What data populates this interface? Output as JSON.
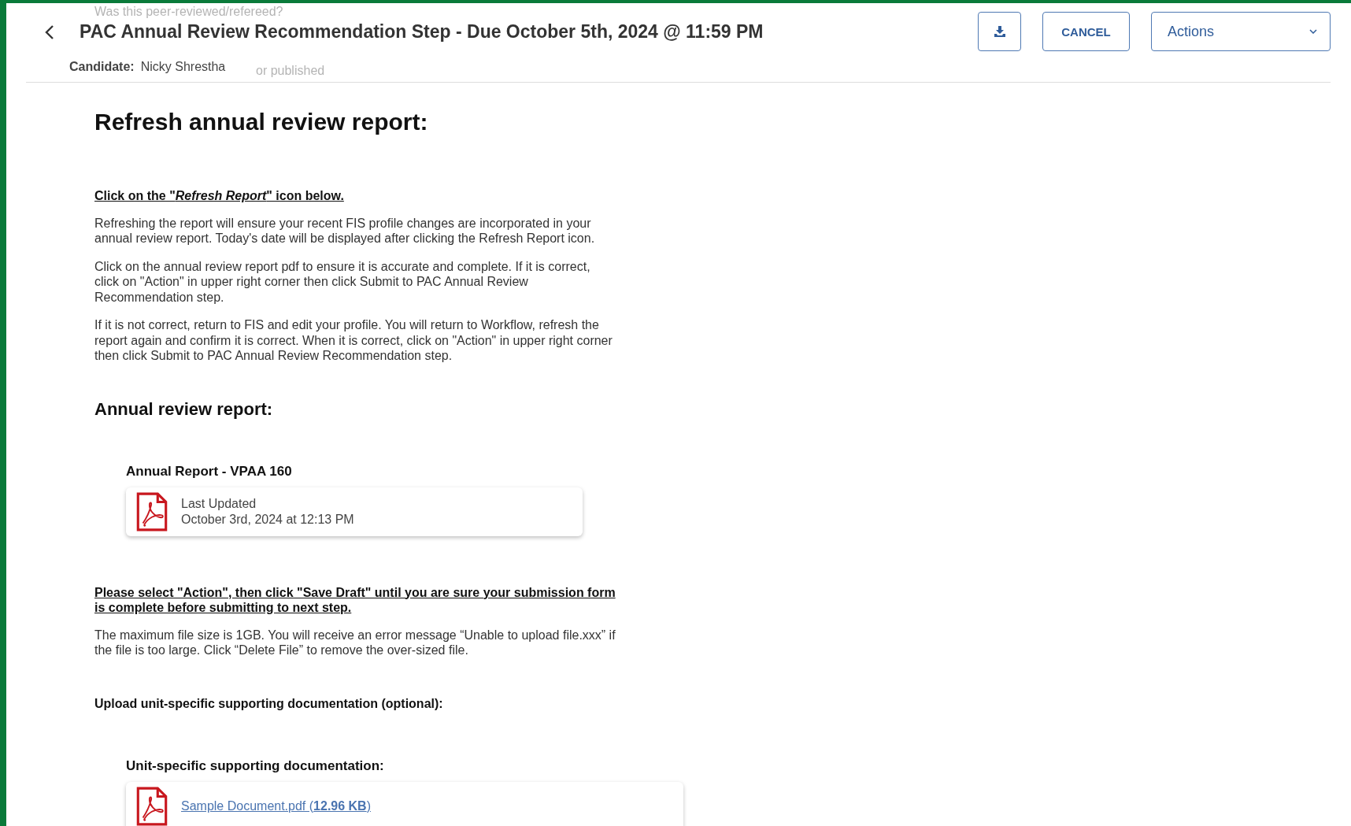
{
  "ghost_texts": [
    "Was this peer-reviewed/refereed?",
    "or published"
  ],
  "header": {
    "title": "PAC Annual Review Recommendation Step - Due October 5th, 2024 @ 11:59 PM",
    "candidate_label": "Candidate:",
    "candidate_name": "Nicky Shrestha",
    "cancel_button": "CANCEL",
    "actions_dropdown": "Actions"
  },
  "sections": [
    {
      "kind": "heading",
      "text": "Refresh annual review report:"
    },
    {
      "kind": "instruction",
      "text": "Click on the \"*Refresh Report*\" icon below. "
    },
    {
      "kind": "paragraph",
      "text": "Refreshing the report will ensure your recent FIS profile changes are incorporated in your annual review report.  Today's date will be displayed after clicking the Refresh Report icon."
    },
    {
      "kind": "paragraph",
      "text": "Click on the annual review report pdf to ensure it is accurate and complete.  If it is correct,  click on \"Action\" in upper right corner then click Submit to PAC Annual Review Recommendation step."
    },
    {
      "kind": "paragraph",
      "text": "If it is not correct, return to FIS and edit your profile.  You will return to Workflow, refresh the report again and confirm it is correct.  When it is correct, click on \"Action\" in upper right corner then click Submit to PAC Annual Review Recommendation step."
    },
    {
      "kind": "subheading",
      "text": "Annual review report:"
    },
    {
      "kind": "file",
      "label": "Annual Report - VPAA 160",
      "lines": [
        "Last Updated",
        "October 3rd, 2024 at 12:13 PM"
      ]
    },
    {
      "kind": "instruction",
      "text": "Please select \"Action\", then click \"Save Draft\" until you are sure your submission form is complete before submitting to next step."
    },
    {
      "kind": "paragraph",
      "text": "The maximum file size is 1GB.  You will receive an error message “Unable to upload file.xxx” if the file is too large.  Click “Delete File” to remove the over-sized file."
    },
    {
      "kind": "label",
      "text": "Upload unit-specific supporting documentation (optional):"
    },
    {
      "kind": "file",
      "label": "Unit-specific supporting documentation:",
      "link": "Sample Document.pdf (**12.96 KB**)"
    }
  ]
}
